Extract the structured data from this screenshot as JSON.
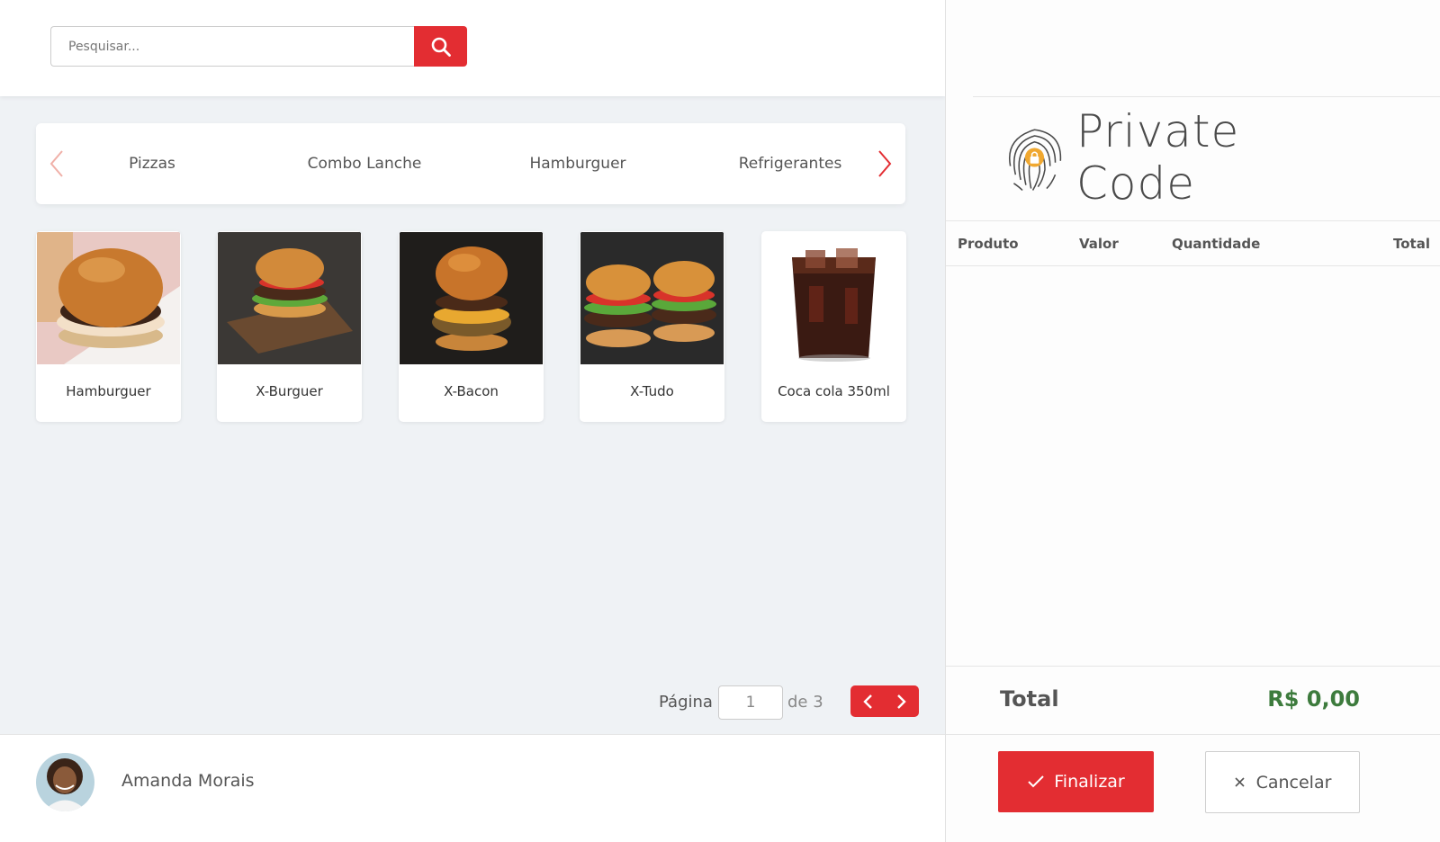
{
  "search": {
    "placeholder": "Pesquisar..."
  },
  "categories": [
    "Pizzas",
    "Combo Lanche",
    "Hamburguer",
    "Refrigerantes"
  ],
  "products": [
    {
      "name": "Hamburguer"
    },
    {
      "name": "X-Burguer"
    },
    {
      "name": "X-Bacon"
    },
    {
      "name": "X-Tudo"
    },
    {
      "name": "Coca cola 350ml"
    }
  ],
  "pagination": {
    "label": "Página",
    "current": "1",
    "of_text": "de 3"
  },
  "user": {
    "name": "Amanda Morais"
  },
  "brand": {
    "name": "Private Code"
  },
  "cart": {
    "columns": {
      "product": "Produto",
      "value": "Valor",
      "quantity": "Quantidade",
      "total": "Total"
    },
    "total_label": "Total",
    "total_value": "R$ 0,00"
  },
  "actions": {
    "finalize": "Finalizar",
    "cancel": "Cancelar"
  },
  "colors": {
    "accent": "#e32d32",
    "total": "#3d7b3d"
  }
}
